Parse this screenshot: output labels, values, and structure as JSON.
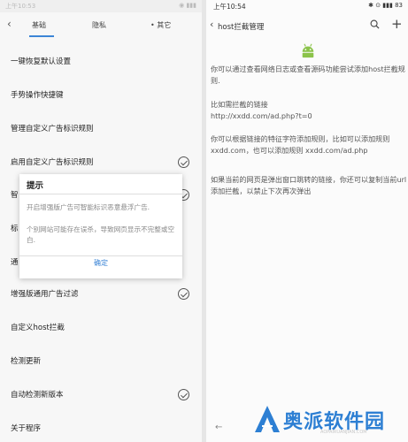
{
  "left_screen": {
    "status_time": "上午10:53",
    "status_right": "◉ ▮▮▮",
    "back_glyph": "‹",
    "tabs": [
      "基础",
      "隐私",
      "其它"
    ],
    "settings": [
      {
        "label": "一键恢复默认设置",
        "checked": false
      },
      {
        "label": "手势操作快捷键",
        "checked": false
      },
      {
        "label": "管理自定义广告标识规则",
        "checked": false
      },
      {
        "label": "启用自定义广告标识规则",
        "checked": true
      },
      {
        "label": "智",
        "checked": true
      },
      {
        "label": "标",
        "checked": false
      },
      {
        "label": "通",
        "checked": false
      },
      {
        "label": "增强版通用广告过滤",
        "checked": true
      },
      {
        "label": "自定义host拦截",
        "checked": false
      },
      {
        "label": "检测更新",
        "checked": false
      },
      {
        "label": "自动检测新版本",
        "checked": true
      },
      {
        "label": "关于程序",
        "checked": false
      }
    ],
    "dialog": {
      "title": "提示",
      "message": "开启增强版广告可智能标识恶意悬浮广告.",
      "note": "个别网站可能存在误杀，导致网页显示不完整或空白.",
      "ok_label": "确定"
    }
  },
  "right_screen": {
    "status_time": "上午10:54",
    "status_right": "✱ ⊙ ▮▮▮ 83",
    "back_glyph": "‹",
    "title": "host拦截管理",
    "plus_glyph": "+",
    "paragraphs": [
      "你可以通过查看网络日志或查看源码功能尝试添加host拦截规则.",
      "比如需拦截的链接",
      "http://xxdd.com/ad.php?t=0",
      "你可以根据链接的特征字符添加规则，比如可以添加规则xxdd.com，也可以添加规则 xxdd.com/ad.php",
      "如果当前的网页是弹出窗口跳转的链接，你还可以复制当前url添加拦截，以禁止下次再次弹出"
    ],
    "nav_back_glyph": "←"
  },
  "watermark": {
    "text": "奥派软件园",
    "url": "AOPAIRUANJIAN.COM"
  },
  "colors": {
    "accent": "#3c85d6",
    "android_green": "#8bc34a",
    "watermark_blue": "#2d7fd3"
  }
}
